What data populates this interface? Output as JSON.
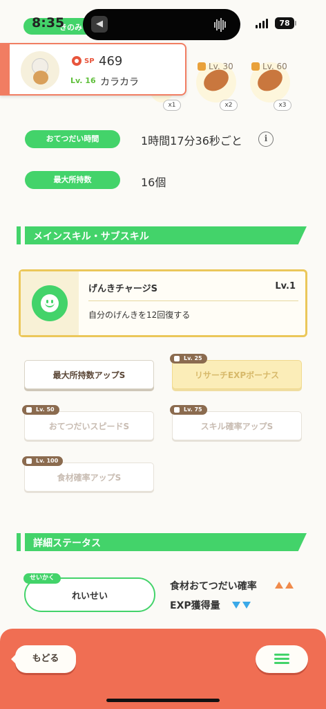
{
  "status_bar": {
    "time": "8:35",
    "battery": "78",
    "tag_text": "きのみ"
  },
  "pokemon": {
    "sp_label": "SP",
    "sp_value": "469",
    "level": "Lv. 16",
    "name": "カラカラ"
  },
  "ingredients": [
    {
      "level": "",
      "qty": "x1"
    },
    {
      "level": "Lv. 30",
      "qty": "x2"
    },
    {
      "level": "Lv. 60",
      "qty": "x3"
    }
  ],
  "stats": {
    "help_time_label": "おてつだい時間",
    "help_time_value": "1時間17分36秒ごと",
    "max_carry_label": "最大所持数",
    "max_carry_value": "16個"
  },
  "skills_section": {
    "title": "メインスキル・サブスキル",
    "main_skill": {
      "name": "げんきチャージS",
      "level": "Lv.1",
      "description": "自分のげんきを12回復する"
    },
    "sub_skills": [
      {
        "label": "最大所持数アップS",
        "lock_level": ""
      },
      {
        "label": "リサーチEXPボーナス",
        "lock_level": "Lv. 25"
      },
      {
        "label": "おてつだいスピードS",
        "lock_level": "Lv. 50"
      },
      {
        "label": "スキル確率アップS",
        "lock_level": "Lv. 75"
      },
      {
        "label": "食材確率アップS",
        "lock_level": "Lv. 100"
      }
    ]
  },
  "details_section": {
    "title": "詳細ステータス",
    "nature_tag": "せいかく",
    "nature_value": "れいせい",
    "up_label": "食材おてつだい確率",
    "down_label": "EXP獲得量",
    "up_color": "#f08a4b",
    "down_color": "#3aa9e8"
  },
  "bottom_bar": {
    "back_label": "もどる"
  },
  "colors": {
    "accent_green": "#43d36a",
    "accent_orange": "#f06e53",
    "gold": "#ebc75a"
  }
}
